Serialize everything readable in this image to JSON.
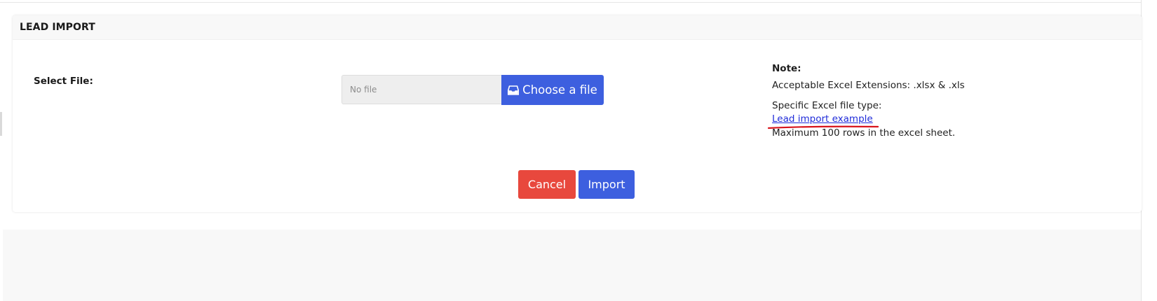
{
  "card": {
    "title": "LEAD IMPORT"
  },
  "form": {
    "select_label": "Select File:",
    "file_placeholder": "No file",
    "choose_label": "Choose a file",
    "choose_icon": "inbox-tray-icon"
  },
  "note": {
    "title": "Note:",
    "extensions": "Acceptable Excel Extensions: .xlsx & .xls",
    "file_type": "Specific Excel file type:",
    "example_link": "Lead import example",
    "max_rows": "Maximum 100 rows in the excel sheet."
  },
  "actions": {
    "cancel_label": "Cancel",
    "import_label": "Import"
  },
  "colors": {
    "primary": "#3d5fdf",
    "danger": "#e8483d",
    "link": "#1f2bd9",
    "annotation": "#d8141c"
  }
}
